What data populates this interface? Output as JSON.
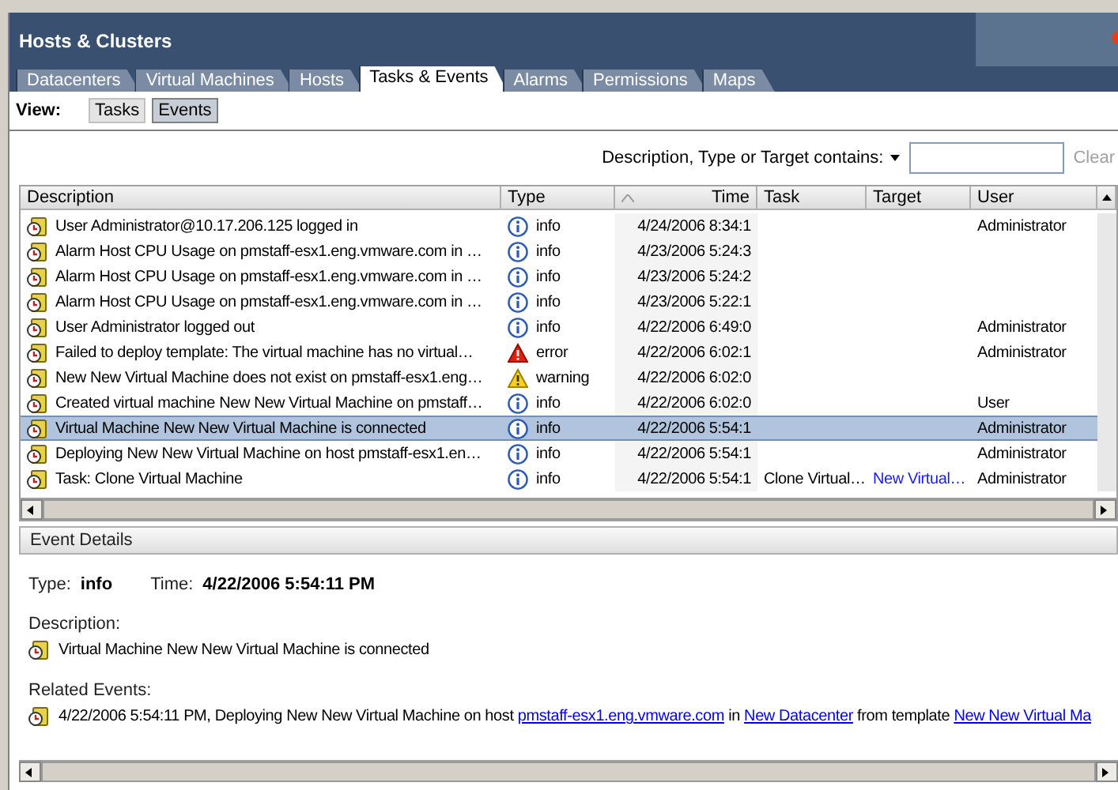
{
  "window": {
    "title": "Hosts & Clusters"
  },
  "tabs": [
    {
      "label": "Datacenters",
      "selected": false
    },
    {
      "label": "Virtual Machines",
      "selected": false
    },
    {
      "label": "Hosts",
      "selected": false
    },
    {
      "label": "Tasks & Events",
      "selected": true
    },
    {
      "label": "Alarms",
      "selected": false
    },
    {
      "label": "Permissions",
      "selected": false
    },
    {
      "label": "Maps",
      "selected": false
    }
  ],
  "view": {
    "label": "View:",
    "buttons": [
      {
        "label": "Tasks",
        "selected": false
      },
      {
        "label": "Events",
        "selected": true
      }
    ]
  },
  "filter": {
    "label": "Description, Type or Target contains:",
    "clear": "Clear"
  },
  "table": {
    "columns": [
      "Description",
      "Type",
      "Time",
      "Task",
      "Target",
      "User"
    ],
    "rows": [
      {
        "description": "User Administrator@10.17.206.125 logged in",
        "kind": "info",
        "type": "info",
        "time": "4/24/2006 8:34:1",
        "user": "Administrator",
        "selected": false
      },
      {
        "description": "Alarm Host CPU Usage on pmstaff-esx1.eng.vmware.com in …",
        "kind": "info",
        "type": "info",
        "time": "4/23/2006 5:24:3",
        "selected": false
      },
      {
        "description": "Alarm Host CPU Usage on pmstaff-esx1.eng.vmware.com in …",
        "kind": "info",
        "type": "info",
        "time": "4/23/2006 5:24:2",
        "selected": false
      },
      {
        "description": "Alarm Host CPU Usage on pmstaff-esx1.eng.vmware.com in …",
        "kind": "info",
        "type": "info",
        "time": "4/23/2006 5:22:1",
        "selected": false
      },
      {
        "description": "User Administrator logged out",
        "kind": "info",
        "type": "info",
        "time": "4/22/2006 6:49:0",
        "user": "Administrator",
        "selected": false
      },
      {
        "description": "Failed to deploy template: The virtual machine has no virtual…",
        "kind": "error",
        "type": "error",
        "time": "4/22/2006 6:02:1",
        "user": "Administrator",
        "selected": false
      },
      {
        "description": "New New Virtual Machine does not exist on pmstaff-esx1.eng…",
        "kind": "warning",
        "type": "warning",
        "time": "4/22/2006 6:02:0",
        "selected": false
      },
      {
        "description": "Created virtual machine New New Virtual Machine on pmstaff…",
        "kind": "info",
        "type": "info",
        "time": "4/22/2006 6:02:0",
        "user": "User",
        "selected": false
      },
      {
        "description": "Virtual Machine New New Virtual Machine is connected",
        "kind": "info",
        "type": "info",
        "time": "4/22/2006 5:54:1",
        "user": "Administrator",
        "selected": true
      },
      {
        "description": "Deploying New New Virtual Machine on host pmstaff-esx1.en…",
        "kind": "info",
        "type": "info",
        "time": "4/22/2006 5:54:1",
        "user": "Administrator",
        "selected": false
      },
      {
        "description": "Task: Clone Virtual Machine",
        "kind": "info",
        "type": "info",
        "time": "4/22/2006 5:54:1",
        "task": "Clone Virtual…",
        "target": "New Virtual…",
        "user": "Administrator",
        "selected": false
      }
    ]
  },
  "event_details": {
    "title": "Event Details",
    "type_label": "Type:",
    "type": "info",
    "time_label": "Time:",
    "time": "4/22/2006 5:54:11 PM",
    "description_label": "Description:",
    "description": "Virtual Machine New New Virtual Machine is connected",
    "related_label": "Related Events:",
    "related": [
      {
        "time": "4/22/2006 5:54:11 PM,",
        "parts": [
          {
            "kind": "text",
            "text": "Deploying New New Virtual Machine on host"
          },
          {
            "kind": "link",
            "text": "pmstaff-esx1.eng.vmware.com"
          },
          {
            "kind": "text",
            "text": "in"
          },
          {
            "kind": "link",
            "text": "New Datacenter"
          },
          {
            "kind": "text",
            "text": "from template"
          },
          {
            "kind": "link",
            "text": "New New Virtual Ma"
          }
        ]
      }
    ]
  }
}
